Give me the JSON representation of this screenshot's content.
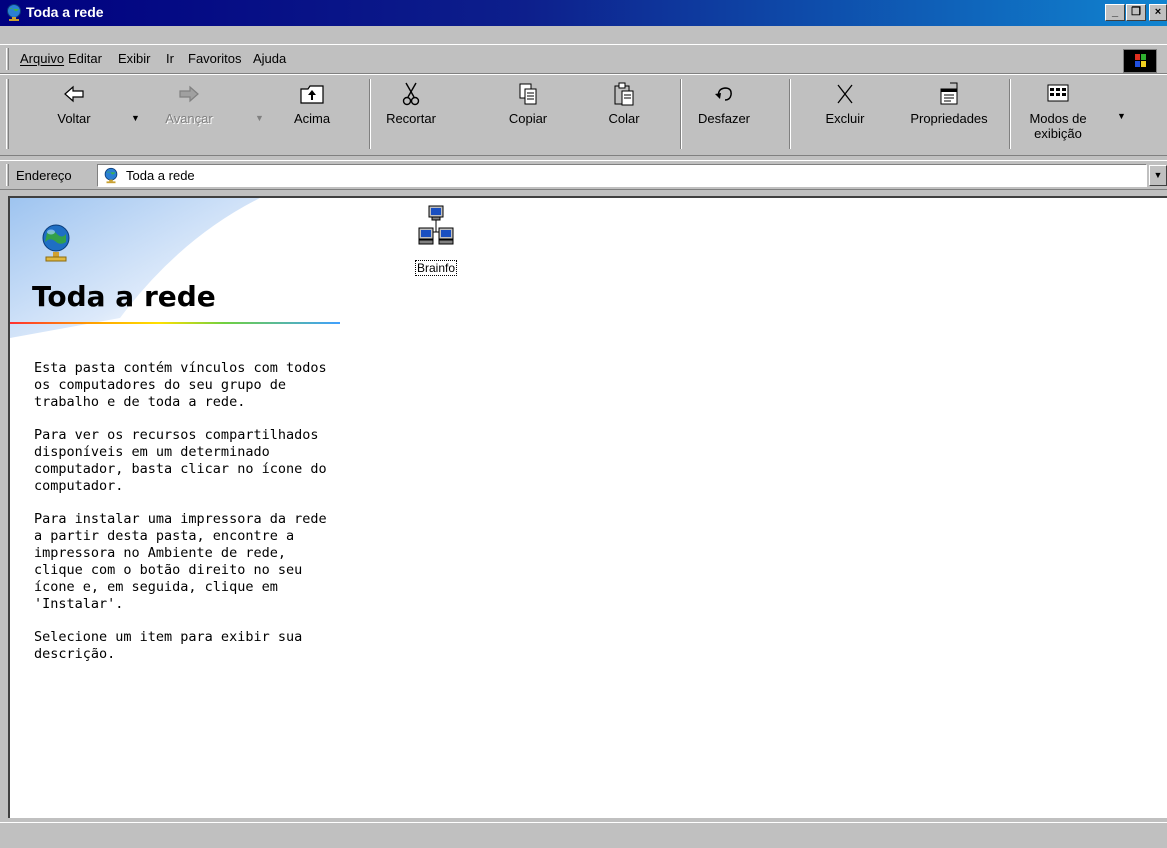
{
  "window": {
    "title": "Toda a rede",
    "icon": "network-neighborhood-globe-icon"
  },
  "menu": [
    {
      "label": "Arquivo",
      "accel": "A"
    },
    {
      "label": "Editar",
      "accel": "E"
    },
    {
      "label": "Exibir",
      "accel": "x"
    },
    {
      "label": "Ir",
      "accel": "I"
    },
    {
      "label": "Favoritos",
      "accel": "F"
    },
    {
      "label": "Ajuda",
      "accel": "j"
    }
  ],
  "toolbar": {
    "back": {
      "label": "Voltar",
      "icon": "back-arrow-icon",
      "enabled": true
    },
    "forward": {
      "label": "Avançar",
      "icon": "forward-arrow-icon",
      "enabled": false
    },
    "up": {
      "label": "Acima",
      "icon": "up-folder-icon",
      "enabled": true
    },
    "cut": {
      "label": "Recortar",
      "icon": "scissors-icon",
      "enabled": true
    },
    "copy": {
      "label": "Copiar",
      "icon": "copy-icon",
      "enabled": true
    },
    "paste": {
      "label": "Colar",
      "icon": "paste-icon",
      "enabled": true
    },
    "undo": {
      "label": "Desfazer",
      "icon": "undo-icon",
      "enabled": true
    },
    "delete": {
      "label": "Excluir",
      "icon": "delete-x-icon",
      "enabled": true
    },
    "properties": {
      "label": "Propriedades",
      "icon": "properties-icon",
      "enabled": true
    },
    "views": {
      "label_line1": "Modos de",
      "label_line2": "exibição",
      "icon": "views-icon",
      "enabled": true
    }
  },
  "address": {
    "label": "Endereço",
    "value": "Toda a rede",
    "icon": "network-neighborhood-globe-icon"
  },
  "content": {
    "folder_title": "Toda a rede",
    "paragraphs": [
      "Esta pasta contém vínculos com todos os computadores do seu grupo de trabalho e de toda a rede.",
      "Para ver os recursos compartilhados disponíveis em um determinado computador, basta clicar no ícone do computador.",
      "Para instalar uma impressora da rede a partir desta pasta, encontre a impressora no Ambiente de rede, clique com o botão direito no seu ícone e, em seguida, clique em 'Instalar'.",
      "Selecione um item para exibir sua descrição."
    ],
    "items": [
      {
        "label": "Brainfo",
        "icon": "network-workgroup-icon"
      }
    ]
  },
  "statusbar": {
    "text": ""
  }
}
